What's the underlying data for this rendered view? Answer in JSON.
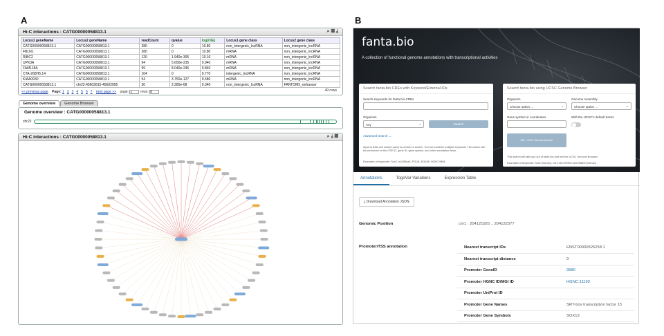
{
  "panel_labels": {
    "a": "A",
    "b": "B"
  },
  "hic_table": {
    "title": "Hi-C interactions : CATG00000058813.1",
    "columns": [
      "Locus1 geneName",
      "Locus2 geneName",
      "readCount",
      "qvalue",
      "log(O/E)",
      "Locus1 gene class",
      "Locus2 gene class"
    ],
    "rows": [
      [
        "CATG00000058813.1",
        "CATG00000058813.1",
        "280",
        "0",
        "10.80",
        "non_intergenic_lncRNA",
        "non_intergenic_lncRNA"
      ],
      [
        "FBLN1",
        "CATG00000058813.1",
        "280",
        "0",
        "10.80",
        "mRNA",
        "non_intergenic_lncRNA"
      ],
      [
        "RIBC2",
        "CATG00000058813.1",
        "120",
        "1.940e-306",
        "10.10",
        "mRNA",
        "non_intergenic_lncRNA"
      ],
      [
        "UPK3A",
        "CATG00000058813.1",
        "94",
        "5.650e-235",
        "9.940",
        "mRNA",
        "non_intergenic_lncRNA"
      ],
      [
        "FAM118A",
        "CATG00000058813.1",
        "99",
        "8.040e-245",
        "9.840",
        "mRNA",
        "non_intergenic_lncRNA"
      ],
      [
        "CTA-268H5.14",
        "CATG00000058813.1",
        "104",
        "0",
        "9.770",
        "intergenic_lncRNA",
        "non_intergenic_lncRNA"
      ],
      [
        "KIAA0930",
        "CATG00000058813.1",
        "54",
        "3.750e-127",
        "9.580",
        "mRNA",
        "non_intergenic_lncRNA"
      ],
      [
        "CATG00000058813.1",
        "chr22:45602815-45602995",
        "30",
        "2.280e-68",
        "9.340",
        "non_intergenic_lncRNA",
        "FANTOM5_enhancer"
      ]
    ],
    "row_count": "49 rows",
    "pager": {
      "prev": "<< previous page",
      "page_label": "Page:",
      "pages": [
        "1",
        "2",
        "3",
        "4",
        "5",
        "6",
        "7"
      ],
      "next": "next page >>",
      "page_input_label": "page:",
      "page_value": "1",
      "rows_label": "rows:",
      "rows_value": "8"
    }
  },
  "tabs": [
    "Genome overview",
    "Genome Browser"
  ],
  "genome_overview": {
    "title": "Genome overview : CATG00000058813.1",
    "chrom": "chr22"
  },
  "network": {
    "title": "Hi-C interactions : CATG00000058813.1"
  },
  "fantabio": {
    "logo": "fanta.bio",
    "tagline": "A collection of functional genome annotations with transcriptional activities",
    "search_card": {
      "title": "Search fanta.bio CREs with Keyword/External IDs",
      "keyword_label": "Search Keywords for fanta.bio CREs",
      "organism_label": "Organism",
      "organism_value": "Any",
      "search_btn": "Search",
      "advanced": "Advanced Search →",
      "help": "Input at least one search query to perform a search. You can combine multiple keywords. The search will be performed on the CRE ID, gene ID, gene symbol, and other annotation fields.",
      "examples": "Examples of keywords: Sox2, rs1183ea3, POU5_301938, HGNC:9884"
    },
    "ucsc_card": {
      "title": "Search fanta.bio using UCSC Genome Browser",
      "organism_label": "Organism",
      "organism_value": "Choose option ...",
      "assembly_label": "Genome Assembly",
      "assembly_value": "Choose option ...",
      "gene_label": "Gene symbol or coordinates",
      "default_tracks": "With the UCSC's default tracks",
      "go_btn": "Go",
      "ucsc_btn": "UCSC Genome Browser",
      "help": "This search will take you out of fanta.bio and into the UCSC Genome Browser.",
      "examples": "Examples of keywords: Sox2 (human), chr1:181702900-181708800 (human)"
    },
    "nav": [
      "Annotations",
      "TogoVar Variations",
      "Expression Table"
    ],
    "download_btn": "Download Annotation JSON",
    "genomic_position_label": "Genomic Position",
    "genomic_position_value": "chr1 : 204121925 .. 204122377",
    "promoter_label": "Promoter/TSS annotation",
    "annotations": [
      {
        "key": "Nearest transcript IDs",
        "value": "ENST00000525258.1"
      },
      {
        "key": "Nearest transcript distance",
        "value": "9"
      },
      {
        "key": "Promoter GeneID",
        "value": "9580"
      },
      {
        "key": "Promoter HGNC ID/MGI ID",
        "value": "HGNC:11192"
      },
      {
        "key": "Promoter UniProt ID",
        "value": ""
      },
      {
        "key": "Promoter Gene Names",
        "value": "SRY-box transcription factor 13"
      },
      {
        "key": "Promoter Gene Symbols",
        "value": "SOX13"
      }
    ],
    "colors": {
      "accent": "#1f6fa8",
      "button": "#9db5c8"
    }
  }
}
